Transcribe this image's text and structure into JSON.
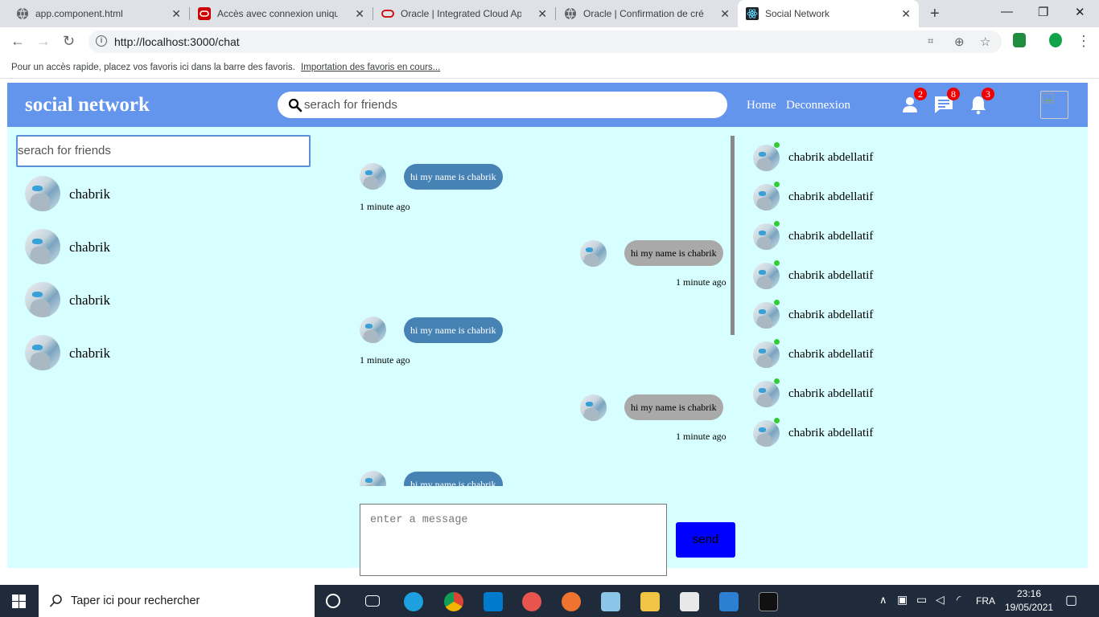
{
  "browser": {
    "tabs": [
      {
        "title": "app.component.html",
        "active": false
      },
      {
        "title": "Accès avec connexion unique",
        "active": false
      },
      {
        "title": "Oracle | Integrated Cloud Appl",
        "active": false
      },
      {
        "title": "Oracle | Confirmation de créati",
        "active": false
      },
      {
        "title": "Social Network",
        "active": true
      }
    ],
    "url": "http://localhost:3000/chat",
    "bookmarks_text": "Pour un accès rapide, placez vos favoris ici dans la barre des favoris.",
    "bookmarks_link": "Importation des favoris en cours..."
  },
  "navbar": {
    "brand": "social network",
    "search_placeholder": "serach for friends",
    "links": [
      "Home",
      "Deconnexion"
    ],
    "badges": {
      "friends": "2",
      "messages": "8",
      "notifications": "3"
    }
  },
  "left": {
    "search_placeholder": "serach for friends",
    "friends": [
      "chabrik",
      "chabrik",
      "chabrik",
      "chabrik"
    ]
  },
  "messages": [
    {
      "text": "hi my name is chabrik",
      "time": "1 minute ago",
      "side": "in"
    },
    {
      "text": "hi my name is chabrik",
      "time": "1 minute ago",
      "side": "out"
    },
    {
      "text": "hi my name is chabrik",
      "time": "1 minute ago",
      "side": "in"
    },
    {
      "text": "hi my name is chabrik",
      "time": "1 minute ago",
      "side": "out"
    },
    {
      "text": "hi my name is chabrik",
      "time": "",
      "side": "in"
    }
  ],
  "composer": {
    "placeholder": "enter a message",
    "send_label": "send"
  },
  "online": [
    "chabrik abdellatif",
    "chabrik abdellatif",
    "chabrik abdellatif",
    "chabrik abdellatif",
    "chabrik abdellatif",
    "chabrik abdellatif",
    "chabrik abdellatif",
    "chabrik abdellatif"
  ],
  "taskbar": {
    "search_placeholder": "Taper ici pour rechercher",
    "lang": "FRA",
    "time": "23:16",
    "date": "19/05/2021"
  }
}
